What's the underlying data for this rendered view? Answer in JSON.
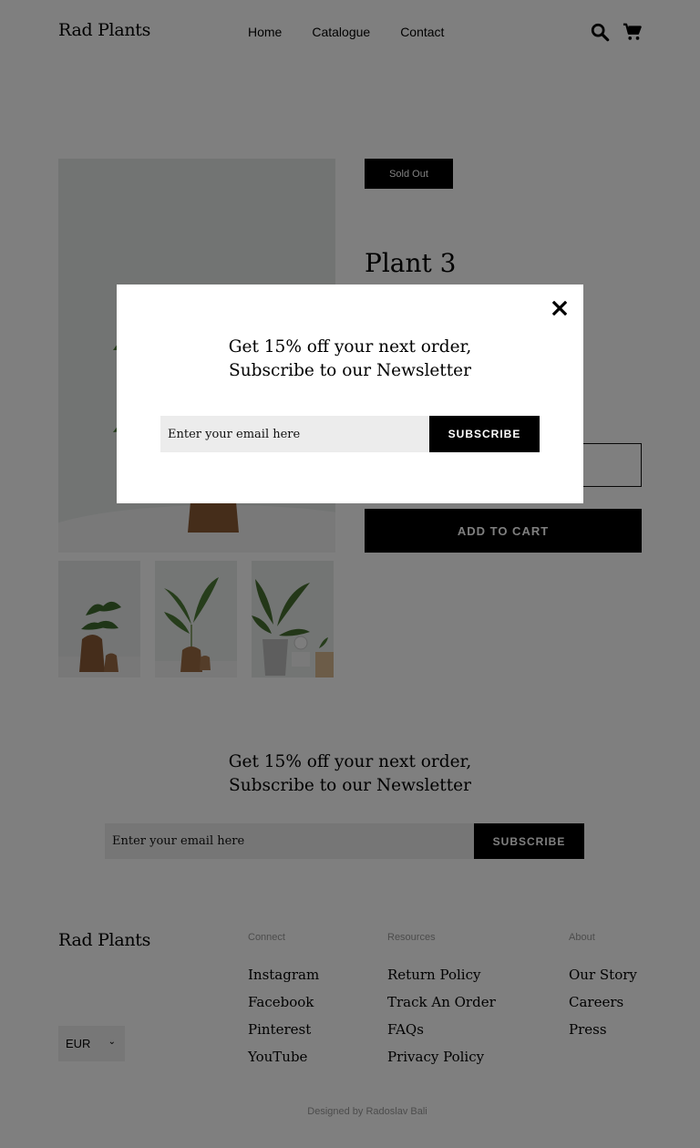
{
  "header": {
    "brand": "Rad Plants",
    "nav": [
      "Home",
      "Catalogue",
      "Contact"
    ],
    "icons": [
      "search-icon",
      "cart-icon"
    ]
  },
  "product": {
    "badge": "Sold Out",
    "title": "Plant 3",
    "add_to_cart": "ADD TO CART"
  },
  "newsletter": {
    "title_line1": "Get 15% off your next order,",
    "title_line2": "Subscribe to our Newsletter",
    "placeholder": "Enter your email here",
    "button": "SUBSCRIBE"
  },
  "popup": {
    "title_line1": "Get 15% off your next order,",
    "title_line2": "Subscribe to our Newsletter",
    "placeholder": "Enter your email here",
    "button": "SUBSCRIBE",
    "close_icon": "close-icon"
  },
  "footer": {
    "brand": "Rad Plants",
    "currency": "EUR",
    "columns": [
      {
        "heading": "Connect",
        "links": [
          "Instagram",
          "Facebook",
          "Pinterest",
          "YouTube"
        ]
      },
      {
        "heading": "Resources",
        "links": [
          "Return Policy",
          "Track An Order",
          "FAQs",
          "Privacy Policy"
        ]
      },
      {
        "heading": "About",
        "links": [
          "Our Story",
          "Careers",
          "Press"
        ]
      }
    ],
    "credit": "Designed by Radoslav Bali"
  },
  "colors": {
    "overlay": "#808080",
    "button": "#000000",
    "input_bg": "#ececec"
  }
}
